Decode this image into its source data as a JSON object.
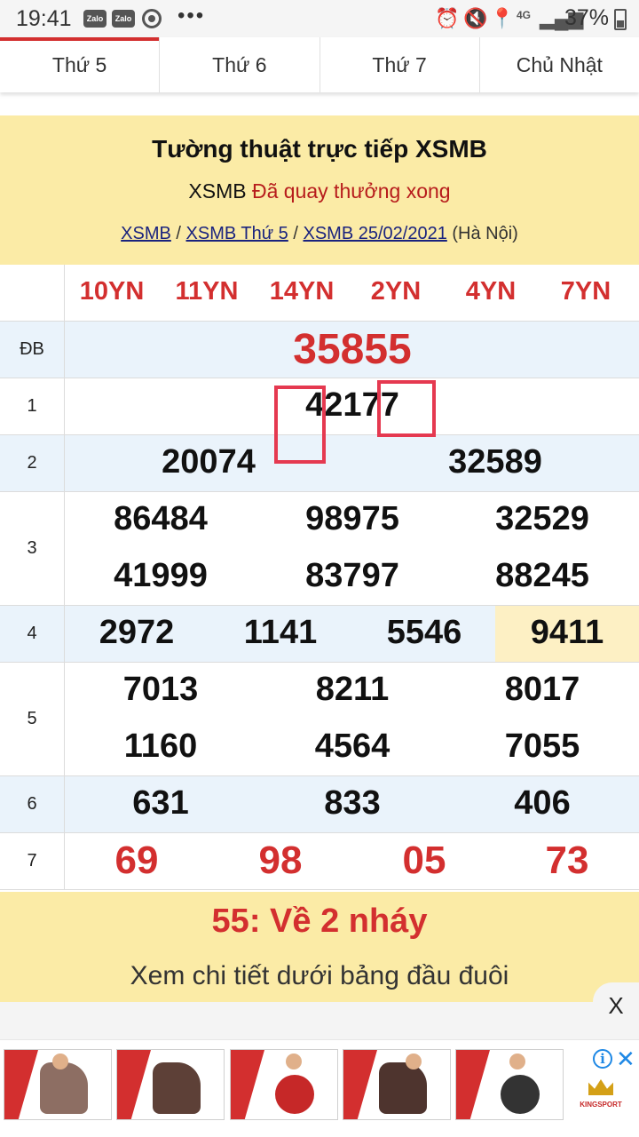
{
  "status_bar": {
    "time": "19:41",
    "apps": [
      "Zalo",
      "Zalo"
    ],
    "more": "•••",
    "network": "4G",
    "battery": "37%"
  },
  "tabs": [
    "Thứ 5",
    "Thứ 6",
    "Thứ 7",
    "Chủ Nhật"
  ],
  "header": {
    "title": "Tường thuật trực tiếp XSMB",
    "sub_prefix": "XSMB",
    "sub_status": "Đã quay thưởng xong",
    "crumbs": [
      "XSMB",
      "XSMB Thứ 5",
      "XSMB 25/02/2021"
    ],
    "crumb_sep": " / ",
    "region": "(Hà Nội)"
  },
  "codes": [
    "10YN",
    "11YN",
    "14YN",
    "2YN",
    "4YN",
    "7YN"
  ],
  "prizes": {
    "db": {
      "label": "ĐB",
      "numbers": [
        "35855"
      ]
    },
    "p1": {
      "label": "1",
      "numbers": [
        "42177"
      ]
    },
    "p2": {
      "label": "2",
      "numbers": [
        "20074",
        "32589"
      ]
    },
    "p3": {
      "label": "3",
      "numbers": [
        "86484",
        "98975",
        "32529",
        "41999",
        "83797",
        "88245"
      ]
    },
    "p4": {
      "label": "4",
      "numbers": [
        "2972",
        "1141",
        "5546",
        "9411"
      ]
    },
    "p5": {
      "label": "5",
      "numbers": [
        "7013",
        "8211",
        "8017",
        "1160",
        "4564",
        "7055"
      ]
    },
    "p6": {
      "label": "6",
      "numbers": [
        "631",
        "833",
        "406"
      ]
    },
    "p7": {
      "label": "7",
      "numbers": [
        "69",
        "98",
        "05",
        "73"
      ]
    }
  },
  "footer": {
    "highlight": "55: Về 2 nháy",
    "detail": "Xem chi tiết dưới bảng đầu đuôi"
  },
  "close_label": "X",
  "ad": {
    "info": "i",
    "close": "✕",
    "brand": "KINGSPORT"
  }
}
